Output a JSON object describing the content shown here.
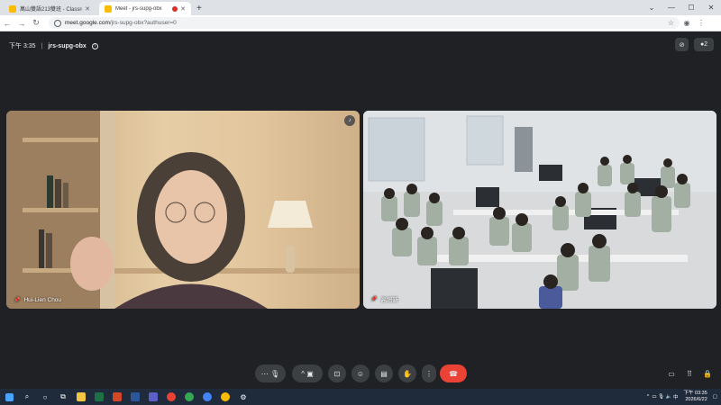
{
  "browser": {
    "tabs": [
      {
        "title": "萬山雙語213雙班 - Classroom",
        "fav_color": "#fbbc04",
        "active": false
      },
      {
        "title": "Meet - jrs-supg-obx",
        "fav_color": "#fbbc04",
        "active": true
      }
    ],
    "new_tab": "+",
    "url_host": "meet.google.com",
    "url_path": "/jrs-supg-obx?authuser=0"
  },
  "meet": {
    "time": "下午 3:35",
    "separator": "|",
    "meeting_code": "jrs-supg-obx",
    "participants": [
      {
        "name": "Hui-Lien Chou"
      },
      {
        "name": "高培新"
      }
    ]
  },
  "taskbar": {
    "time": "下午 03:35",
    "date": "2026/6/22",
    "lang": "中"
  },
  "colors": {
    "background": "#202124",
    "end_call": "#ea4335",
    "control": "#3c4043"
  }
}
